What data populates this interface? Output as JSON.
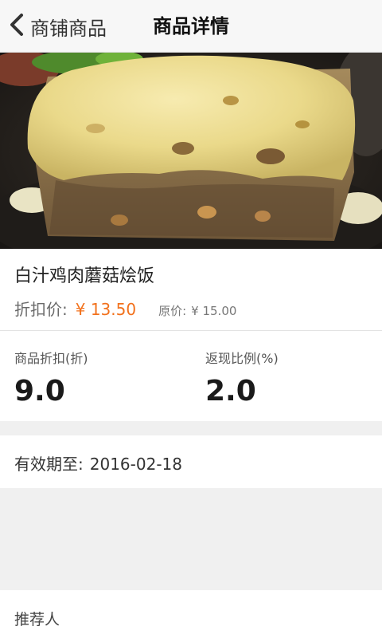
{
  "nav": {
    "back_label": "商铺商品",
    "title": "商品详情"
  },
  "product": {
    "name": "白汁鸡肉蘑菇烩饭",
    "discount_price_label": "折扣价:",
    "discount_price": "¥ 13.50",
    "original_price_label": "原价:",
    "original_price": "¥ 15.00"
  },
  "stats": {
    "discount_label": "商品折扣(折)",
    "discount_value": "9.0",
    "cashback_label": "返现比例(%)",
    "cashback_value": "2.0"
  },
  "validity": {
    "label": "有效期至:",
    "date": "2016-02-18"
  },
  "referrer": {
    "label": "推荐人"
  },
  "colors": {
    "accent": "#f2711c",
    "separator": "#f0f0f0"
  },
  "icons": {
    "back": "chevron-left-icon"
  }
}
